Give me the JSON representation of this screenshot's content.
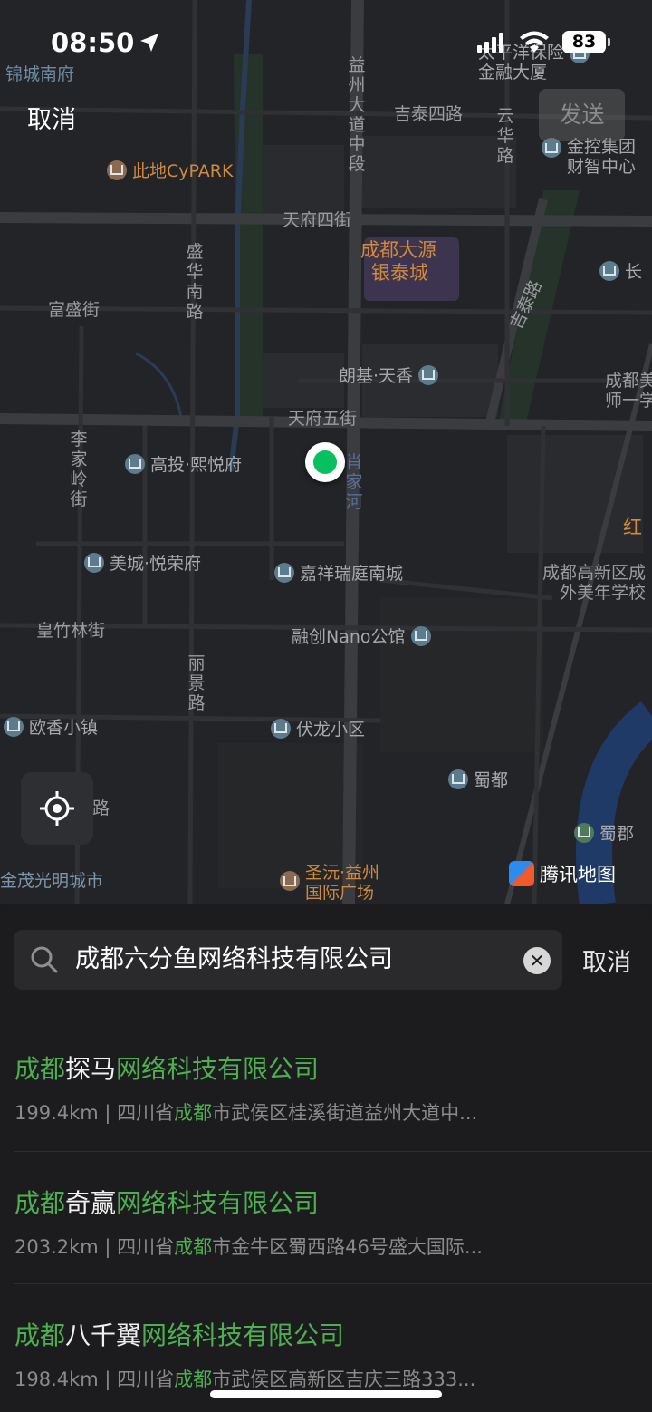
{
  "status_bar": {
    "time": "08:50",
    "battery": "83"
  },
  "top_bar": {
    "cancel": "取消",
    "send": "发送"
  },
  "map": {
    "roads": {
      "yizhou_avenue": "益州大道中段",
      "jitai_4th": "吉泰四路",
      "yunhua": "云华路",
      "tianfu_4th": "天府四街",
      "shenghua_south": "盛华南路",
      "fusheng": "富盛街",
      "jitai": "吉泰路",
      "tianfu_5th": "天府五街",
      "lijialing": "李家岭街",
      "xiaojiahe": "肖家河",
      "huangzhulin": "皇竹林街",
      "lijing": "丽景路",
      "lu": "路",
      "jinjiang_nanfu": "锦城南府"
    },
    "pois": {
      "cypark": "此地CyPARK",
      "taiping_l1": "太平洋保险",
      "taiping_l2": "金融大厦",
      "jinkong_l1": "金控集团",
      "jinkong_l2": "财智中心",
      "dayuan_l1": "成都大源",
      "dayuan_l2": "银泰城",
      "zhang": "长",
      "langji": "朗基·天香",
      "chengdu_mei_l1": "成都美",
      "chengdu_mei_l2": "师一学",
      "gaotou": "高投·熙悦府",
      "hong": "红",
      "meicheng": "美城·悦荣府",
      "jiaxiang": "嘉祥瑞庭南城",
      "gaoxin_school_l1": "成都高新区成",
      "gaoxin_school_l2": "外美年学校",
      "rongchuang": "融创Nano公馆",
      "ouxiang": "欧香小镇",
      "fulong": "伏龙小区",
      "shudu": "蜀都",
      "shudu_park": "蜀郡",
      "jinmao": "金茂光明城市",
      "shengyuan_l1": "圣沅·益州",
      "shengyuan_l2": "国际广场"
    },
    "attribution": "腾讯地图"
  },
  "search": {
    "query": "成都六分鱼网络科技有限公司",
    "cancel": "取消"
  },
  "results": [
    {
      "t1": "成都",
      "t2": "探马",
      "t3": "网络科技有限公司",
      "a1": "199.4km | 四川省",
      "a2": "成都",
      "a3": "市武侯区桂溪街道益州大道中..."
    },
    {
      "t1": "成都",
      "t2": "奇赢",
      "t3": "网络科技有限公司",
      "a1": "203.2km | 四川省",
      "a2": "成都",
      "a3": "市金牛区蜀西路46号盛大国际..."
    },
    {
      "t1": "成都",
      "t2": "八千翼",
      "t3": "网络科技有限公司",
      "a1": "198.4km | 四川省",
      "a2": "成都",
      "a3": "市武侯区高新区吉庆三路333..."
    }
  ],
  "colors": {
    "highlight": "#4caf50",
    "accent": "#07c160"
  },
  "icons": [
    "location-arrow-icon",
    "signal-icon",
    "wifi-icon",
    "battery-icon",
    "search-icon",
    "clear-icon",
    "locate-icon",
    "building-pin-icon",
    "shop-pin-icon",
    "tencent-map-logo"
  ]
}
